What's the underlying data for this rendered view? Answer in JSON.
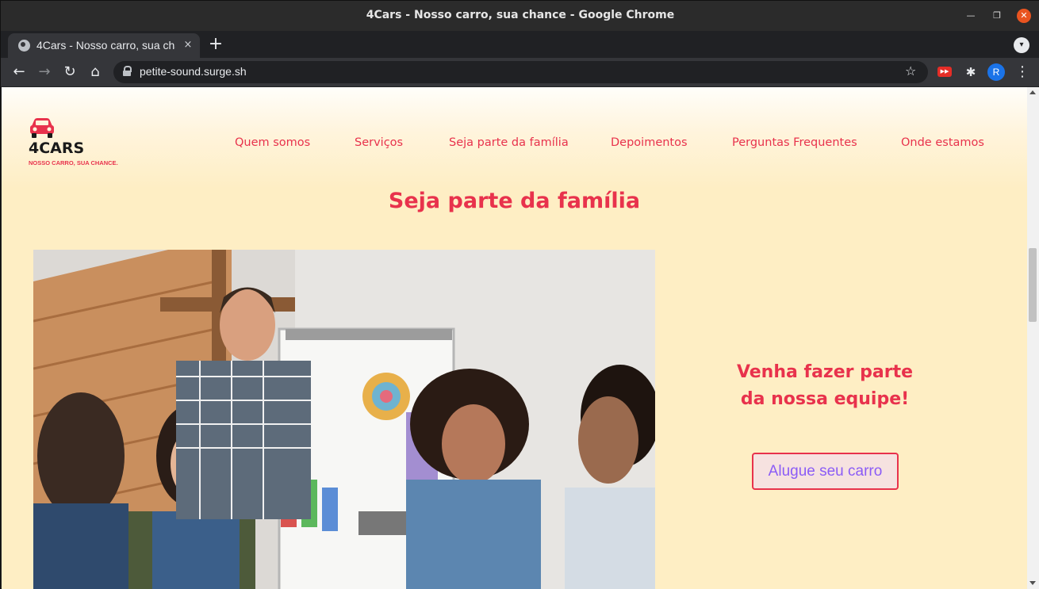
{
  "window": {
    "title": "4Cars - Nosso carro, sua chance - Google Chrome",
    "minimize_icon": "minimize-icon",
    "maximize_icon": "maximize-icon",
    "close_icon": "close-icon"
  },
  "tab": {
    "title": "4Cars - Nosso carro, sua chance",
    "close": "×",
    "new_tab": "+"
  },
  "toolbar": {
    "url": "petite-sound.surge.sh",
    "back": "←",
    "forward": "→",
    "reload": "↻",
    "home": "⌂",
    "star": "☆",
    "profile_initial": "R",
    "menu": "⋮"
  },
  "logo": {
    "brand": "4CARS",
    "tagline": "NOSSO CARRO, SUA CHANCE."
  },
  "nav": {
    "items": [
      {
        "label": "Quem somos"
      },
      {
        "label": "Serviços"
      },
      {
        "label": "Seja parte da família"
      },
      {
        "label": "Depoimentos"
      },
      {
        "label": "Perguntas Frequentes"
      },
      {
        "label": "Onde estamos"
      }
    ]
  },
  "section": {
    "title": "Seja parte da família",
    "cta_line1": "Venha fazer parte",
    "cta_line2": "da nossa equipe!",
    "button": "Alugue seu carro"
  },
  "colors": {
    "accent": "#e8324c",
    "page_bg": "#feeec4",
    "button_text": "#8b5cf6"
  }
}
